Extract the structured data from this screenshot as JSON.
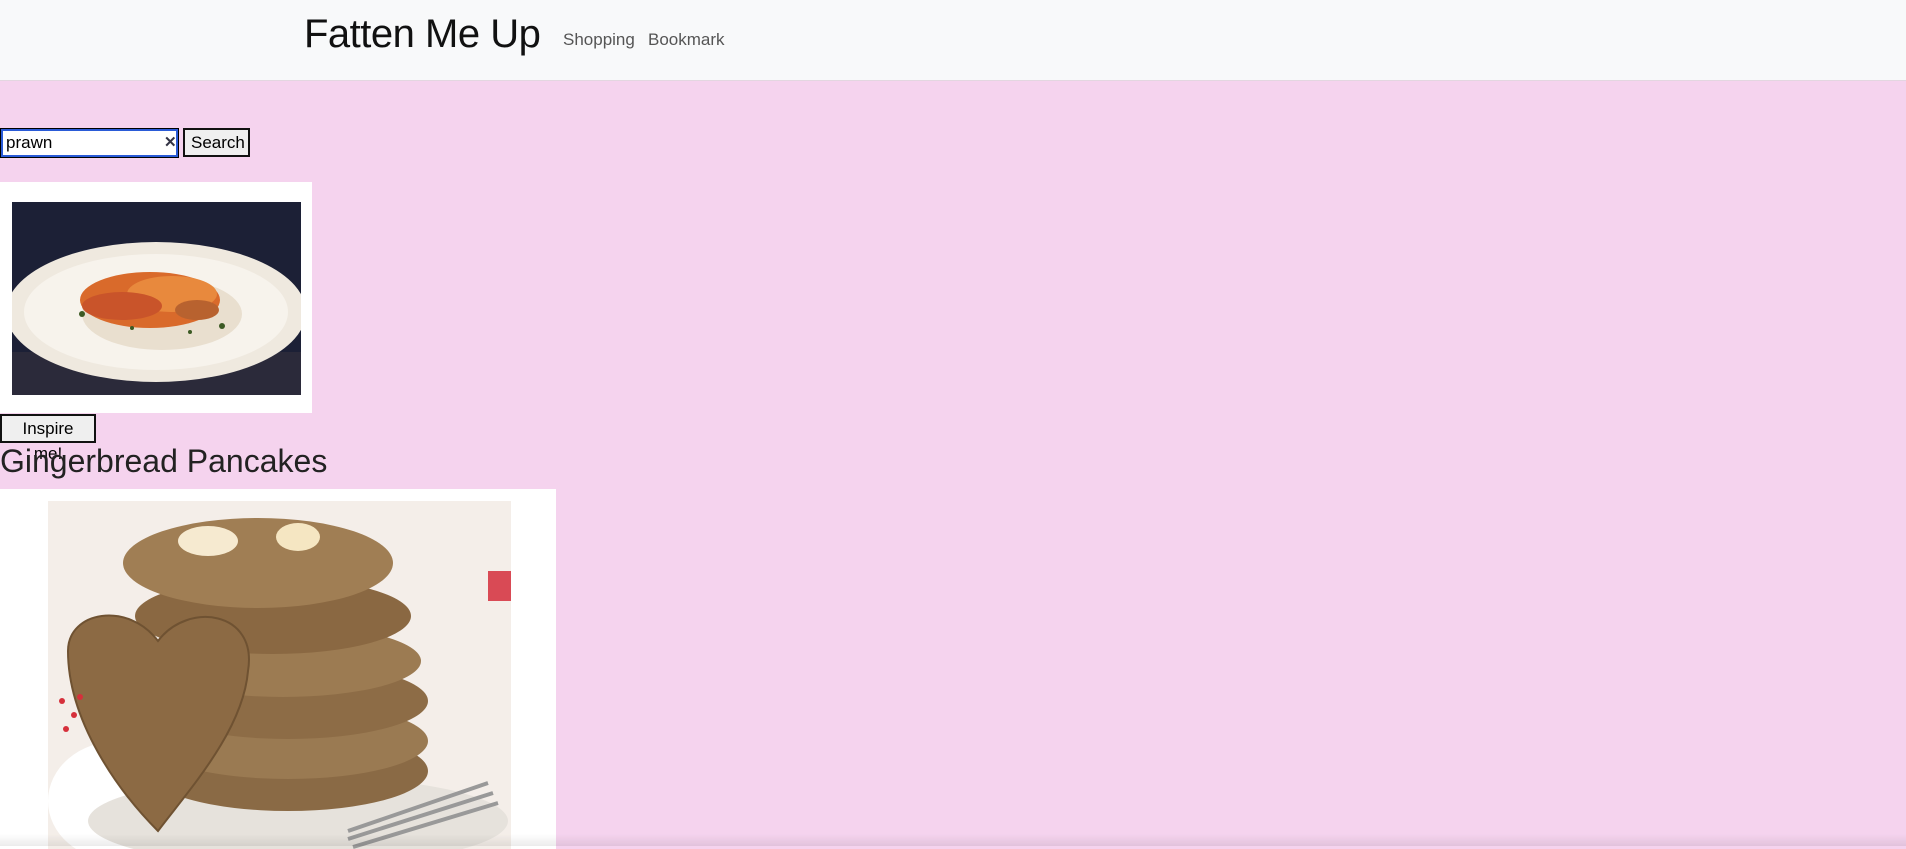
{
  "navbar": {
    "brand": "Fatten Me Up",
    "links": [
      "Shopping",
      "Bookmark"
    ]
  },
  "search": {
    "value": "prawn",
    "button_label": "Search"
  },
  "inspire": {
    "button_label": "Inspire me!"
  },
  "recipe": {
    "title": "Gingerbread Pancakes"
  },
  "colors": {
    "page_bg": "#f5d3ee",
    "navbar_bg": "#f8f9fa"
  }
}
